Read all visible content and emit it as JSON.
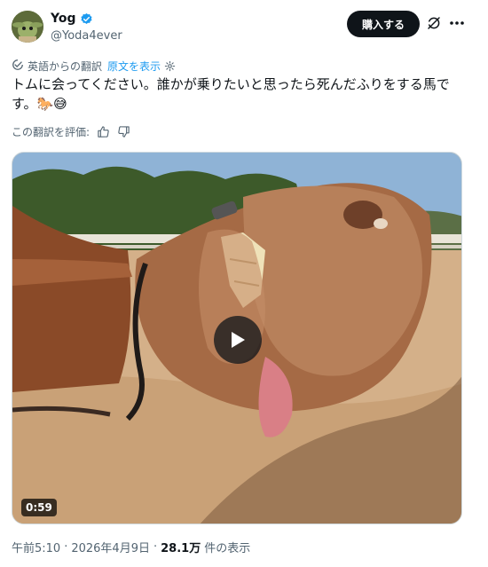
{
  "author": {
    "display_name": "Yog",
    "handle": "@Yoda4ever",
    "avatar_icon": "yoda-avatar",
    "verified_icon": "verified-badge-icon",
    "verified_color": "#1d9bf0"
  },
  "header": {
    "buy_label": "購入する",
    "grok_icon": "grok-icon",
    "more_icon": "more-icon"
  },
  "translation": {
    "label": "英語からの翻訳",
    "show_original": "原文を表示",
    "rate_label": "この翻訳を評価:"
  },
  "tweet": {
    "text": "トムに会ってください。誰かが乗りたいと思ったら死んだふりをする馬で\nす。🐎😅"
  },
  "video": {
    "duration": "0:59",
    "play_icon": "play-icon"
  },
  "meta": {
    "time": "午前5:10",
    "separator": "·",
    "date": "2026年4月9日",
    "views_count": "28.1万",
    "views_label": "件の表示"
  },
  "colors": {
    "text": "#0f1419",
    "secondary": "#536471",
    "link": "#1d9bf0",
    "button_bg": "#0f1419"
  }
}
